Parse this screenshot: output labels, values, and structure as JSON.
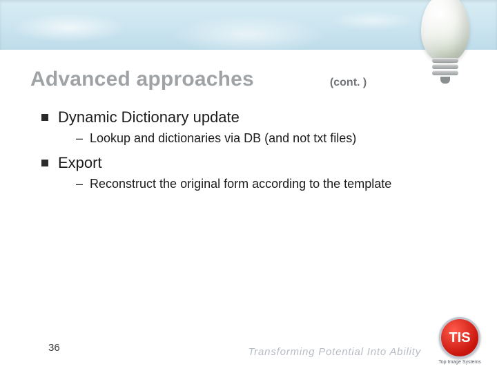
{
  "title": "Advanced approaches",
  "cont_label": "(cont. )",
  "bullets": [
    {
      "text": "Dynamic Dictionary update",
      "subs": [
        "Lookup and dictionaries via DB (and not txt files)"
      ]
    },
    {
      "text": "Export",
      "subs": [
        "Reconstruct the original form according to the template"
      ]
    }
  ],
  "page_number": "36",
  "tagline": "Transforming Potential Into Ability",
  "logo": {
    "initials": "TIS",
    "subtitle": "Top Image Systems"
  }
}
